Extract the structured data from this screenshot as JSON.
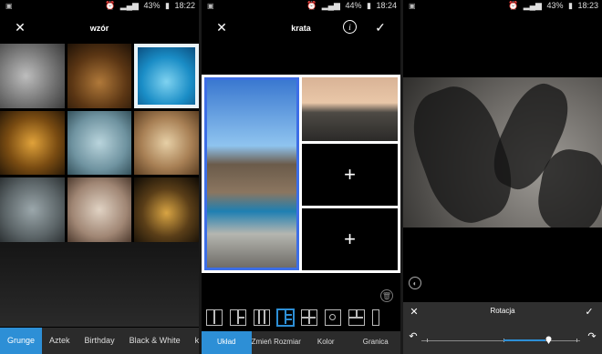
{
  "panel1": {
    "status": {
      "left_icon": "image-icon",
      "alarm_icon": "alarm-icon",
      "wifi_icon": "signal-icon",
      "battery": "43%",
      "time": "18:22"
    },
    "title": "wzór",
    "tabs": [
      "Grunge",
      "Aztek",
      "Birthday",
      "Black & White",
      "k"
    ],
    "active_tab": "Grunge"
  },
  "panel2": {
    "status": {
      "battery": "44%",
      "time": "18:24"
    },
    "title": "krata",
    "bottom_tabs": [
      "Układ",
      "Zmień Rozmiar",
      "Kolor",
      "Granica"
    ],
    "active_tab": "Układ",
    "plus_symbol": "+",
    "info_symbol": "i"
  },
  "panel3": {
    "status": {
      "battery": "43%",
      "time": "18:23"
    },
    "rotation_label": "Rotacja"
  },
  "colors": {
    "accent": "#2d8fd6",
    "background": "#000000",
    "tabbar": "#2b2b2b"
  }
}
